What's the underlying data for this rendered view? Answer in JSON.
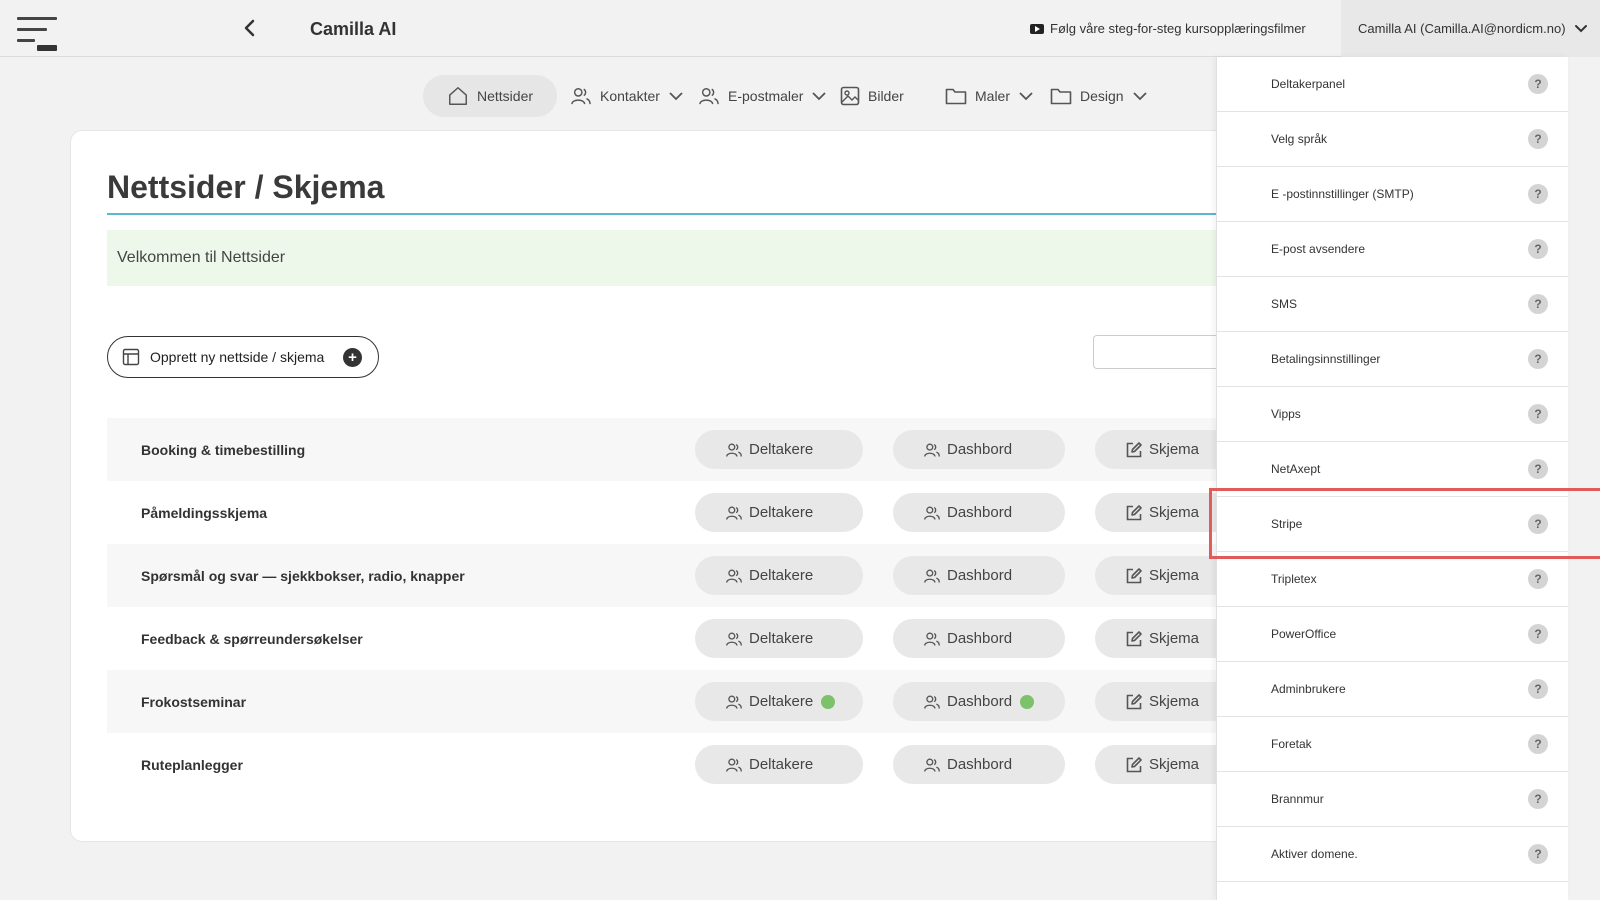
{
  "app": {
    "title": "Camilla AI"
  },
  "header": {
    "tutorial_link": "Følg våre steg-for-steg kursopplæringsfilmer",
    "user_label": "Camilla AI (Camilla.AI@nordicm.no)"
  },
  "nav": {
    "items": [
      {
        "label": "Nettsider",
        "icon": "home-icon",
        "active": true
      },
      {
        "label": "Kontakter",
        "icon": "users-icon",
        "dropdown": true
      },
      {
        "label": "E-postmaler",
        "icon": "users-icon",
        "dropdown": true
      },
      {
        "label": "Bilder",
        "icon": "image-icon"
      },
      {
        "label": "Maler",
        "icon": "folder-icon",
        "dropdown": true
      },
      {
        "label": "Design",
        "icon": "folder-icon",
        "dropdown": true
      }
    ]
  },
  "main": {
    "title": "Nettsider / Skjema",
    "welcome": "Velkommen til Nettsider",
    "create_button": "Opprett ny nettside / skjema",
    "search_placeholder": "",
    "rows": [
      {
        "name": "Booking & timebestilling",
        "btn1": "Deltakere",
        "btn2": "Dashbord",
        "btn3": "Skjema"
      },
      {
        "name": "Påmeldingsskjema",
        "btn1": "Deltakere",
        "btn2": "Dashbord",
        "btn3": "Skjema"
      },
      {
        "name": "Spørsmål og svar — sjekkbokser, radio, knapper",
        "btn1": "Deltakere",
        "btn2": "Dashbord",
        "btn3": "Skjema"
      },
      {
        "name": "Feedback & spørreundersøkelser",
        "btn1": "Deltakere",
        "btn2": "Dashbord",
        "btn3": "Skjema"
      },
      {
        "name": "Frokostseminar",
        "btn1": "Deltakere",
        "btn2": "Dashbord",
        "btn3": "Skjema"
      },
      {
        "name": "Ruteplanlegger",
        "btn1": "Deltakere",
        "btn2": "Dashbord",
        "btn3": "Skjema"
      }
    ]
  },
  "settings_menu": {
    "help_symbol": "?",
    "items": [
      "Deltakerpanel",
      "Velg språk",
      "E -postinnstillinger (SMTP)",
      "E-post avsendere",
      "SMS",
      "Betalingsinnstillinger",
      "Vipps",
      "NetAxept",
      "Stripe",
      "Tripletex",
      "PowerOffice",
      "Adminbrukere",
      "Foretak",
      "Brannmur",
      "Aktiver domene."
    ]
  },
  "colors": {
    "accent_rule": "#56b8d6",
    "highlight": "#e15b5b",
    "status_dot": "#7cc26a",
    "welcome_bg": "#eef8ea"
  }
}
